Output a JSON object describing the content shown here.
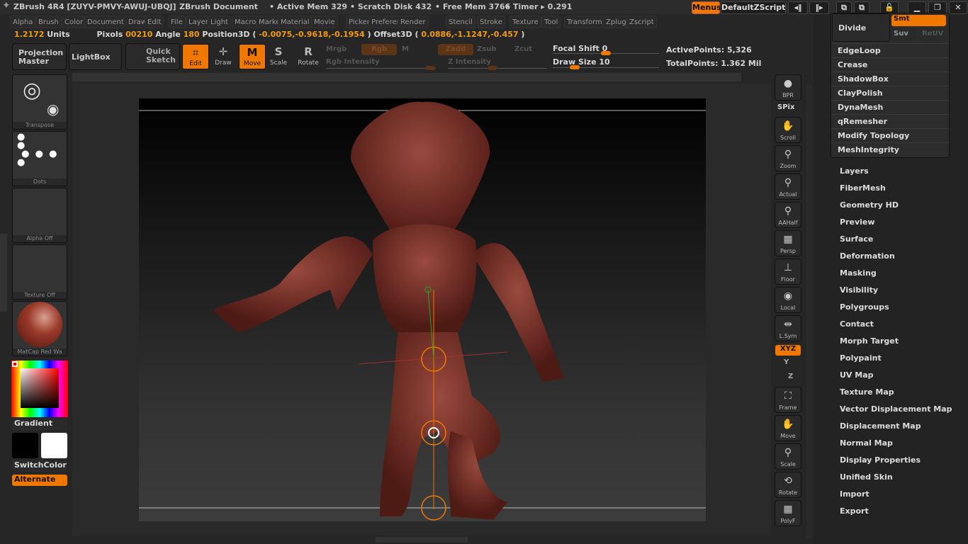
{
  "titlebar": {
    "app": "ZBrush 4R4 [ZUYV-PMVY-AWUJ-UBQJ]",
    "document": "ZBrush Document",
    "active_mem": "• Active Mem 329",
    "scratch": "• Scratch Disk 432",
    "free_mem": "• Free Mem 3766",
    "timer": "• Timer ▸ 0.291",
    "menus": "Menus",
    "default_zscript": "DefaultZScript"
  },
  "menubar": [
    "Alpha",
    "Brush",
    "Color",
    "Document",
    "Draw",
    "Edit",
    "File",
    "Layer",
    "Light",
    "Macro",
    "Marker",
    "Material",
    "Movie",
    "Picker",
    "Preferences",
    "Render",
    "Stencil",
    "Stroke",
    "Texture",
    "Tool",
    "Transform",
    "Zplugin",
    "Zscript"
  ],
  "info": {
    "units_val": "1.2172",
    "units": "Units",
    "pixols_label": "Pixols",
    "pixols": "00210",
    "angle_label": "Angle",
    "angle": "180",
    "pos_label": "Position3D (",
    "pos": "-0.0075,-0.9618,-0.1954",
    "close": ")",
    "offset_label": "Offset3D (",
    "offset": "0.0886,-1.1247,-0.457"
  },
  "toolbar": {
    "projection_master": "Projection Master",
    "lightbox": "LightBox",
    "quick_sketch": "Quick Sketch",
    "edit": "Edit",
    "draw": "Draw",
    "move": "Move",
    "scale": "Scale",
    "rotate": "Rotate",
    "mrgb": "Mrgb",
    "rgb": "Rgb",
    "m": "M",
    "zadd": "Zadd",
    "zsub": "Zsub",
    "zcut": "Zcut",
    "rgb_intensity": "Rgb Intensity",
    "z_intensity": "Z Intensity",
    "focal_shift": "Focal Shift",
    "focal_shift_val": "0",
    "draw_size": "Draw Size",
    "draw_size_val": "10",
    "active_points": "ActivePoints: 5,326",
    "total_points": "TotalPoints: 1.362 Mil"
  },
  "left_shelf": {
    "transpose": "Transpose",
    "dots": "Dots",
    "alpha": "Alpha Off",
    "texture": "Texture Off",
    "material": "MatCap Red Wa",
    "gradient": "Gradient",
    "switchcolor": "SwitchColor",
    "alternate": "Alternate"
  },
  "right_shelf": [
    "BPR",
    "SPix",
    "Scroll",
    "Zoom",
    "Actual",
    "AAHalf",
    "Persp",
    "Floor",
    "Local",
    "L.Sym",
    "XYZ",
    "Y",
    "Z",
    "Frame",
    "Move",
    "Scale",
    "Rotate",
    "PolyF"
  ],
  "popup": {
    "divide": "Divide",
    "smt": "Smt",
    "suv": "Suv",
    "reuv": "ReUV",
    "items": [
      "EdgeLoop",
      "Crease",
      "ShadowBox",
      "ClayPolish",
      "DynaMesh",
      "qRemesher",
      "Modify Topology",
      "MeshIntegrity"
    ]
  },
  "tool_palette": [
    "Layers",
    "FiberMesh",
    "Geometry HD",
    "Preview",
    "Surface",
    "Deformation",
    "Masking",
    "Visibility",
    "Polygroups",
    "Contact",
    "Morph Target",
    "Polypaint",
    "UV Map",
    "Texture Map",
    "Vector Displacement Map",
    "Displacement Map",
    "Normal Map",
    "Display Properties",
    "Unified Skin",
    "Import",
    "Export"
  ],
  "colors": {
    "accent": "#f07800",
    "highlight_text": "#f39c12",
    "model": "#7a2f26"
  }
}
